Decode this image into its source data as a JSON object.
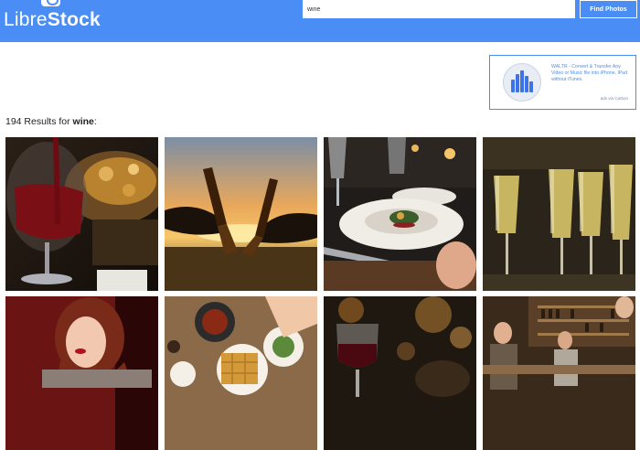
{
  "header": {
    "logo_part1": "Libre",
    "logo_part2": "Stock",
    "search_value": "wine",
    "find_button": "Find Photos"
  },
  "ad": {
    "text": "WALTR - Convert & Transfer Any Video or Music file into iPhone, iPad without iTunes.",
    "via": "ads via Carbon"
  },
  "results": {
    "count_text": "194 Results for",
    "keyword": "wine",
    "suffix": ":"
  },
  "photos": [
    {
      "subject": "red wine being poured into glass next to a plate of food"
    },
    {
      "subject": "two beer bottles clinking at sunset"
    },
    {
      "subject": "restaurant table with plated dish and wine glasses"
    },
    {
      "subject": "rows of champagne glasses"
    },
    {
      "subject": "portrait of woman with red lipstick"
    },
    {
      "subject": "overhead table with waffles and food"
    },
    {
      "subject": "glass of red wine in a dim bar"
    },
    {
      "subject": "people at a wine bar"
    }
  ]
}
